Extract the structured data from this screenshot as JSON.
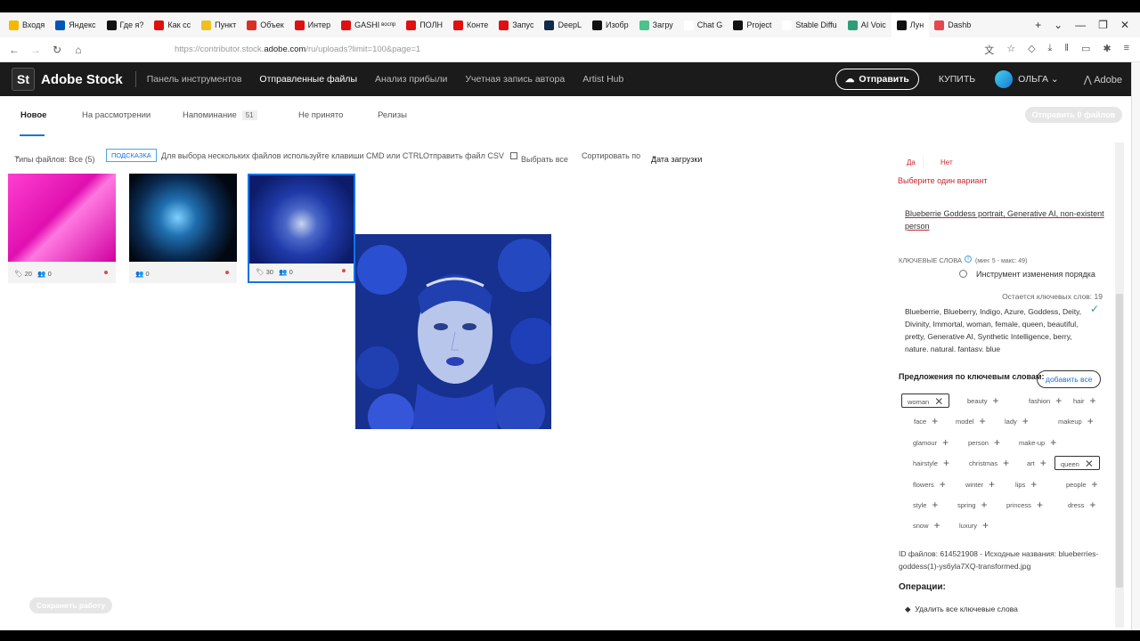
{
  "browser": {
    "tabs": [
      {
        "label": "Входя",
        "color": "#f5b800"
      },
      {
        "label": "Яндекс",
        "color": "#0057b7"
      },
      {
        "label": "Где я?",
        "color": "#111111"
      },
      {
        "label": "Как сс",
        "color": "#e01010"
      },
      {
        "label": "Пункт",
        "color": "#f0c020"
      },
      {
        "label": "Объек",
        "color": "#d93025"
      },
      {
        "label": "Интер",
        "color": "#e01010"
      },
      {
        "label": "GASHI",
        "color": "#e01010"
      },
      {
        "label": "ПОЛН",
        "color": "#e01010"
      },
      {
        "label": "Конте",
        "color": "#e01010"
      },
      {
        "label": "Запус",
        "color": "#e01010"
      },
      {
        "label": "DeepL",
        "color": "#0f2b46"
      },
      {
        "label": "Изобр",
        "color": "#111111"
      },
      {
        "label": "Загру",
        "color": "#4cc38a"
      },
      {
        "label": "Chat G",
        "color": "#ffffff"
      },
      {
        "label": "Project",
        "color": "#111111"
      },
      {
        "label": "Stable Diffu",
        "color": "#ffffff"
      },
      {
        "label": "AI Voic",
        "color": "#2d9d78"
      },
      {
        "label": "Лун",
        "color": "#111111"
      },
      {
        "label": "Dashb",
        "color": "#e34850"
      }
    ],
    "tab_subtitle": "воспр",
    "url_prefix": "https://contributor.stock.",
    "url_domain": "adobe.com",
    "url_suffix": "/ru/uploads?limit=100&page=1"
  },
  "header": {
    "logo": "St",
    "brand": "Adobe Stock",
    "nav": [
      "Панель инструментов",
      "Отправленные файлы",
      "Анализ прибыли",
      "Учетная запись автора",
      "Artist Hub"
    ],
    "send_label": "Отправить",
    "buy_label": "КУПИТЬ",
    "user": "ОЛЬГА",
    "adobe": "Adobe"
  },
  "subtabs": {
    "items": [
      "Новое",
      "На рассмотрении",
      "Напоминание",
      "Не принято",
      "Релизы"
    ],
    "reminder_count": "51",
    "send_files": "Отправить 0 файлов"
  },
  "filter": {
    "types": "Типы файлов: Все (5)",
    "hint": "ПОДСКАЗКА",
    "hint_text": "Для выбора нескольких файлов используйте клавиши CMD или CTRL",
    "csv": "Отправить файл CSV",
    "select_all": "Выбрать все",
    "sort_label": "Сортировать по",
    "sort_value": "Дата загрузки"
  },
  "thumbnails": [
    {
      "kw": "20",
      "people": "0"
    },
    {
      "kw": "",
      "people": "0"
    },
    {
      "kw": "30",
      "people": "0"
    }
  ],
  "save_work": "Сохранить работу",
  "panel": {
    "yes": "Да",
    "no": "Нет",
    "error": "Выберите один вариант",
    "title": "Blueberrie Goddess portrait, Generative AI, non-existent person",
    "kw_label": "КЛЮЧЕВЫЕ СЛОВА",
    "kw_range": "(мин: 5 - макс: 49)",
    "reorder": "Инструмент изменения порядка",
    "remaining": "Остается ключевых слов: 19",
    "keywords_text": "Blueberrie, Blueberry, Indigo, Azure, Goddess, Deity, Divinity, Immortal, woman, female, queen, beautiful, pretty, Generative AI, Synthetic Intelligence, berry, nature, natural, fantasy, blue",
    "suggestions_label": "Предложения по ключевым словам:",
    "add_all": "добавить все",
    "chips": [
      {
        "t": "woman",
        "on": true
      },
      {
        "t": "beauty"
      },
      {
        "t": "fashion"
      },
      {
        "t": "hair"
      },
      {
        "t": "face"
      },
      {
        "t": "model"
      },
      {
        "t": "lady"
      },
      {
        "t": "makeup"
      },
      {
        "t": "glamour"
      },
      {
        "t": "person"
      },
      {
        "t": "make-up"
      },
      {
        "t": "hairstyle"
      },
      {
        "t": "christmas"
      },
      {
        "t": "art"
      },
      {
        "t": "queen",
        "on": true
      },
      {
        "t": "flowers"
      },
      {
        "t": "winter"
      },
      {
        "t": "lips"
      },
      {
        "t": "people"
      },
      {
        "t": "style"
      },
      {
        "t": "spring"
      },
      {
        "t": "princess"
      },
      {
        "t": "dress"
      },
      {
        "t": "snow"
      },
      {
        "t": "luxury"
      }
    ],
    "file_id": "ID файлов: 614521908 - Исходные названия: blueberries-goddess(1)-ys6yla7XQ-transformed.jpg",
    "operations": "Операции:",
    "delete_all": "Удалить все ключевые слова"
  }
}
